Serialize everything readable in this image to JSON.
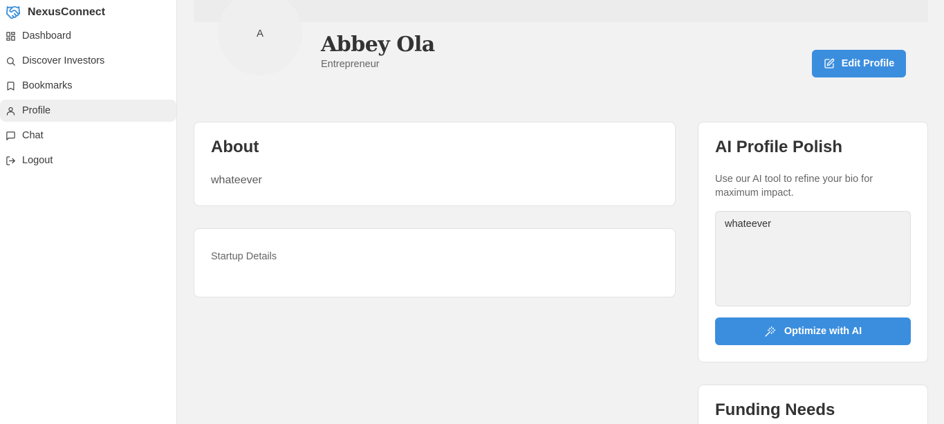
{
  "app": {
    "name": "NexusConnect"
  },
  "colors": {
    "accent": "#3b8ede",
    "brand_icon": "#3b8ede"
  },
  "sidebar": {
    "items": [
      {
        "label": "Dashboard",
        "icon": "dashboard-icon"
      },
      {
        "label": "Discover Investors",
        "icon": "search-icon"
      },
      {
        "label": "Bookmarks",
        "icon": "bookmark-icon"
      },
      {
        "label": "Profile",
        "icon": "user-icon",
        "active": true
      },
      {
        "label": "Chat",
        "icon": "chat-icon"
      },
      {
        "label": "Logout",
        "icon": "logout-icon"
      }
    ]
  },
  "profile": {
    "avatar_initial": "A",
    "name": "Abbey Ola",
    "role": "Entrepreneur",
    "edit_label": "Edit Profile"
  },
  "about": {
    "title": "About",
    "text": "whateever"
  },
  "startup": {
    "label": "Startup Details"
  },
  "ai_polish": {
    "title": "AI Profile Polish",
    "description": "Use our AI tool to refine your bio for maximum impact.",
    "bio_value": "whateever",
    "button_label": "Optimize with AI"
  },
  "funding": {
    "title": "Funding Needs"
  }
}
